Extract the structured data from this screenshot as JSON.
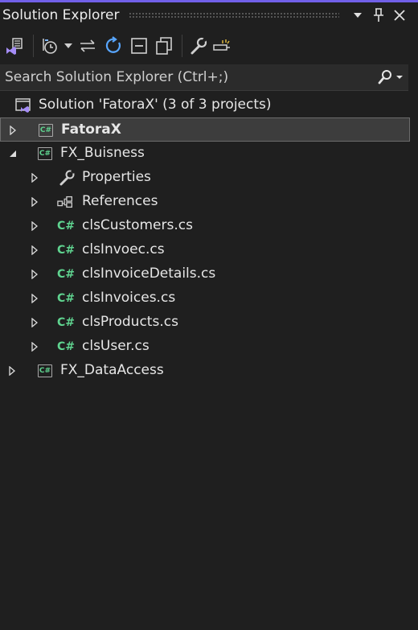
{
  "panel": {
    "title": "Solution Explorer",
    "accent": "#7160e8"
  },
  "window_buttons": [
    "chevron-down-icon",
    "pin-icon",
    "close-icon"
  ],
  "toolbar": {
    "items": [
      "vs-home-icon",
      "history-icon",
      "dropdown-arrow-icon",
      "sync-icon",
      "refresh-icon",
      "collapse-all-icon",
      "show-all-files-icon",
      "properties-wrench-icon",
      "preview-icon"
    ]
  },
  "search": {
    "placeholder": "Search Solution Explorer (Ctrl+;)",
    "value": ""
  },
  "tree": {
    "solution": "Solution 'FatoraX' (3 of 3 projects)",
    "projects": [
      {
        "name": "FatoraX",
        "expanded": false,
        "selected": true,
        "bold": true
      },
      {
        "name": "FX_Buisness",
        "expanded": true,
        "children": [
          {
            "name": "Properties",
            "icon": "wrench-icon"
          },
          {
            "name": "References",
            "icon": "references-icon"
          },
          {
            "name": "clsCustomers.cs",
            "icon": "csharp-file-icon",
            "glyph": "C#"
          },
          {
            "name": "clsInvoec.cs",
            "icon": "csharp-file-icon",
            "glyph": "C#"
          },
          {
            "name": "clsInvoiceDetails.cs",
            "icon": "csharp-file-icon",
            "glyph": "C#"
          },
          {
            "name": "clsInvoices.cs",
            "icon": "csharp-file-icon",
            "glyph": "C#"
          },
          {
            "name": "clsProducts.cs",
            "icon": "csharp-file-icon",
            "glyph": "C#"
          },
          {
            "name": "clsUser.cs",
            "icon": "csharp-file-icon",
            "glyph": "C#"
          }
        ]
      },
      {
        "name": "FX_DataAccess",
        "expanded": false
      }
    ],
    "project_glyph": "C#"
  }
}
